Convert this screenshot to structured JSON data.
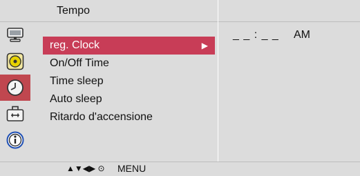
{
  "header": {
    "title": "Tempo"
  },
  "sidebar": {
    "icons": [
      {
        "name": "monitor-icon"
      },
      {
        "name": "audio-speaker-icon"
      },
      {
        "name": "clock-icon",
        "active": true
      },
      {
        "name": "toolbox-icon"
      },
      {
        "name": "info-icon"
      }
    ]
  },
  "menu": {
    "items": [
      {
        "label": "reg. Clock",
        "selected": true,
        "arrow": "▶"
      },
      {
        "label": "On/Off Time"
      },
      {
        "label": "Time sleep"
      },
      {
        "label": "Auto sleep"
      },
      {
        "label": "Ritardo d'accensione"
      }
    ]
  },
  "panel": {
    "time": "_ _ : _ _",
    "ampm": "AM"
  },
  "footer": {
    "nav": "▲▼◀▶ ⊙",
    "menu": "MENU"
  },
  "colors": {
    "selected": "#c83d57",
    "active_icon_bg": "#c0474f",
    "panel_bg": "#dcdcdc"
  }
}
